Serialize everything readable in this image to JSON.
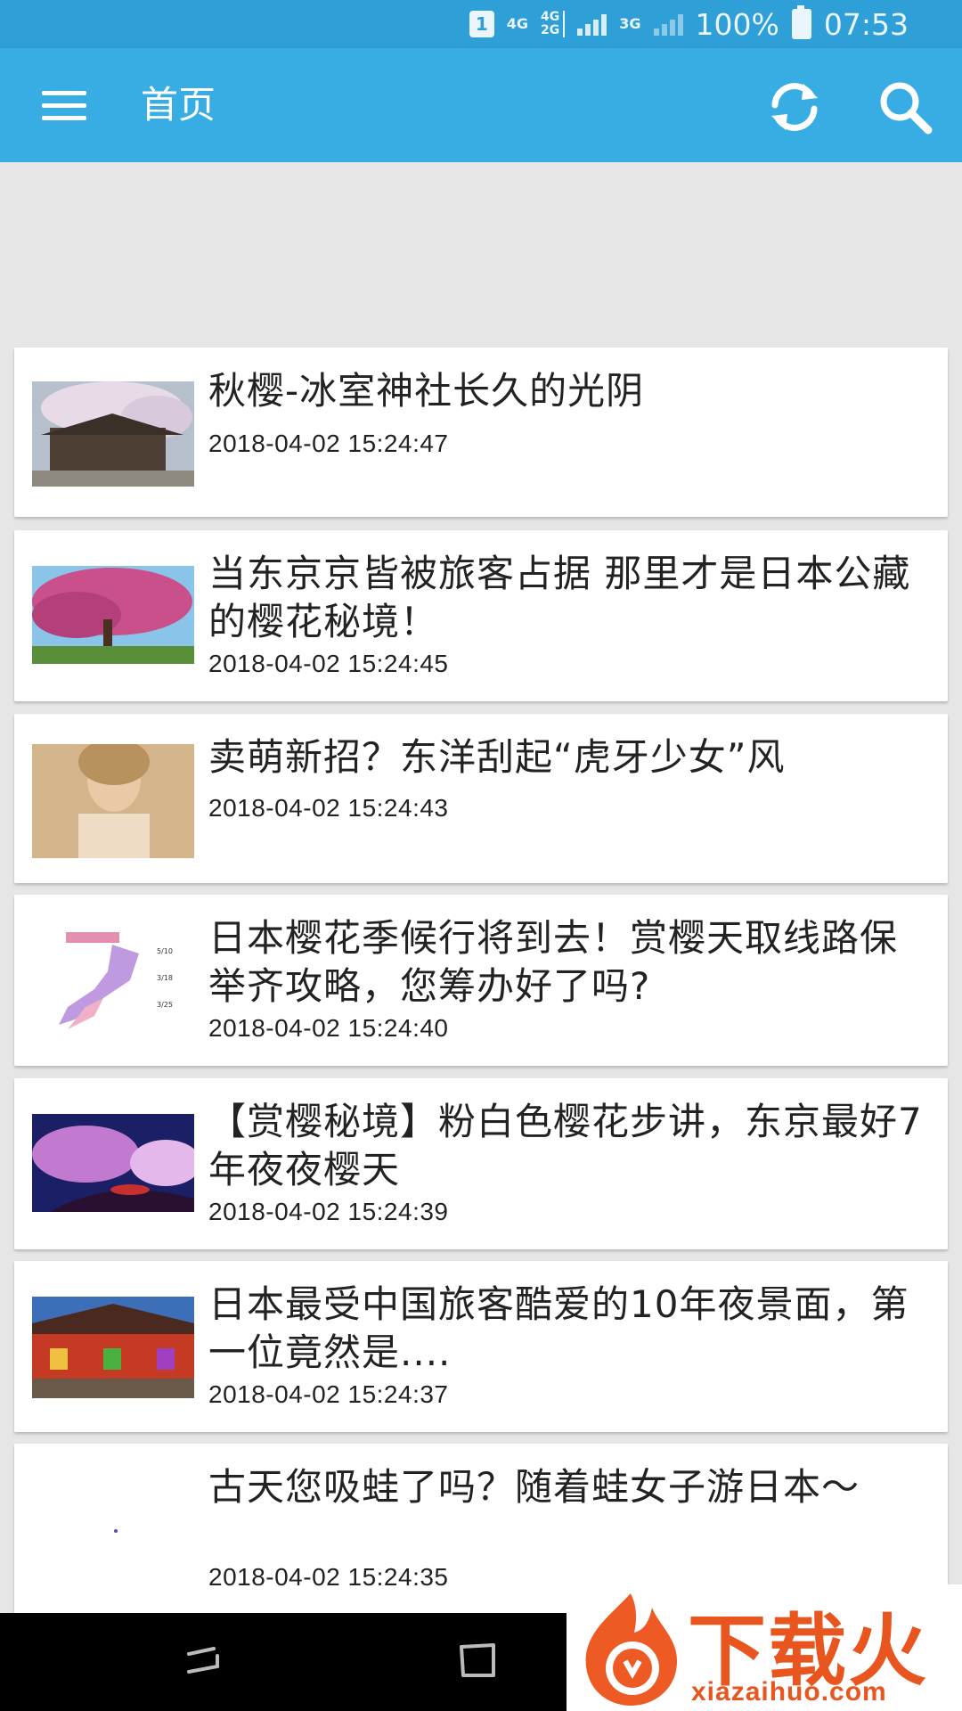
{
  "status_bar": {
    "sim_badge": "1",
    "network_4g": "4G",
    "network_4g2g_top": "4G",
    "network_4g2g_bottom": "2G",
    "network_3g": "3G",
    "battery": "100%",
    "time": "07:53"
  },
  "app_bar": {
    "title": "首页",
    "menu_icon": "hamburger-menu-icon",
    "refresh_icon": "refresh-icon",
    "search_icon": "search-icon",
    "color": "#38ade4"
  },
  "articles": [
    {
      "title": "秋樱-冰室神社长久的光阴",
      "time": "2018-04-02 15:24:47",
      "thumb": "cherry-blossom-shrine"
    },
    {
      "title": "当东京京皆被旅客占据 那里才是日本公藏的樱花秘境！",
      "time": "2018-04-02 15:24:45",
      "thumb": "pink-cherry-tree"
    },
    {
      "title": "卖萌新招？东洋刮起“虎牙少女”风",
      "time": "2018-04-02 15:24:43",
      "thumb": "girl-portrait"
    },
    {
      "title": "日本樱花季候行将到去！赏樱天取线路保举齐攻略，您筹办好了吗?",
      "time": "2018-04-02 15:24:40",
      "thumb": "sakura-forecast-map"
    },
    {
      "title": "【赏樱秘境】粉白色樱花步讲，东京最好7年夜夜樱天",
      "time": "2018-04-02 15:24:39",
      "thumb": "night-sakura"
    },
    {
      "title": "日本最受中国旅客酷爱的10年夜景面，第一位竟然是....",
      "time": "2018-04-02 15:24:37",
      "thumb": "temple-gate"
    },
    {
      "title": "古天您吸蛙了吗？随着蛙女子游日本～",
      "time": "2018-04-02 15:24:35",
      "thumb": "blank"
    }
  ],
  "nav_bar": {
    "back_icon": "recent-apps-icon",
    "home_icon": "overview-icon"
  },
  "watermark": {
    "text": "下载火",
    "url": "xiazaihuo.com"
  }
}
